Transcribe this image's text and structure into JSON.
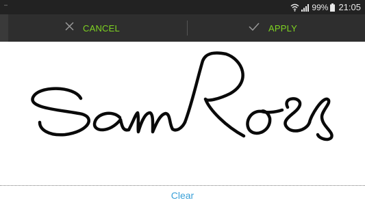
{
  "status_bar": {
    "battery": "99%",
    "time": "21:05",
    "left_indicator": "–"
  },
  "action_bar": {
    "cancel_label": "CANCEL",
    "apply_label": "APPLY",
    "accent_color": "#7ed321"
  },
  "signature": {
    "clear_label": "Clear"
  }
}
